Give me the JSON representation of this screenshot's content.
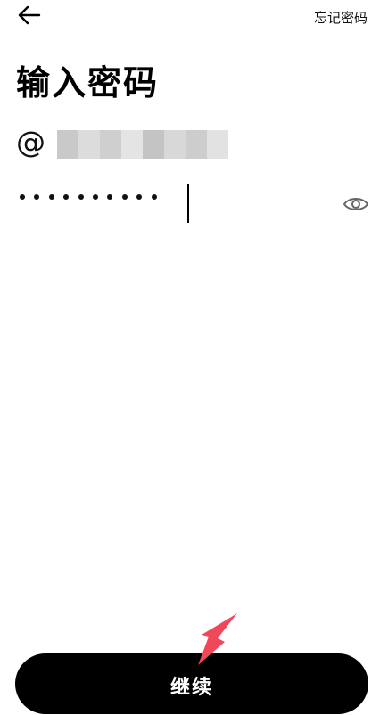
{
  "header": {
    "back_icon": "arrow-left-icon",
    "forgot_password_label": "忘记密码"
  },
  "main": {
    "title": "输入密码",
    "account": {
      "prefix": "@",
      "username_obscured": true
    },
    "password": {
      "masked_length": 10,
      "visibility_icon": "eye-icon"
    }
  },
  "footer": {
    "continue_label": "继续"
  },
  "annotation": {
    "type": "arrow",
    "color": "#f0485a",
    "points_to": "continue-button"
  }
}
